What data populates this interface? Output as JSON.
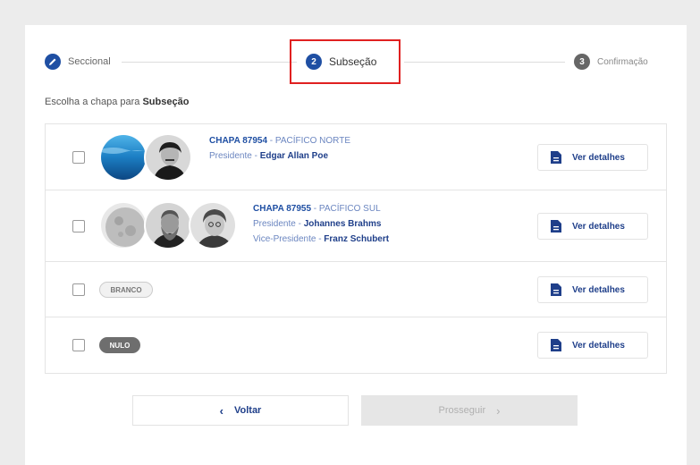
{
  "stepper": {
    "steps": [
      {
        "label": "Seccional",
        "state": "done"
      },
      {
        "label": "Subseção",
        "number": "2",
        "state": "active"
      },
      {
        "label": "Confirmação",
        "number": "3",
        "state": "pending"
      }
    ]
  },
  "prompt": {
    "text": "Escolha a chapa para ",
    "emphasis": "Subseção"
  },
  "options": [
    {
      "chapa": "CHAPA 87954",
      "region": " - PACÍFICO NORTE",
      "members": [
        {
          "role": "Presidente - ",
          "name": "Edgar Allan Poe"
        }
      ],
      "details_label": "Ver detalhes"
    },
    {
      "chapa": "CHAPA 87955",
      "region": " - PACÍFICO SUL",
      "members": [
        {
          "role": "Presidente - ",
          "name": "Johannes Brahms"
        },
        {
          "role": "Vice-Presidente - ",
          "name": "Franz Schubert"
        }
      ],
      "details_label": "Ver detalhes"
    },
    {
      "badge": "BRANCO",
      "details_label": "Ver detalhes"
    },
    {
      "badge": "NULO",
      "details_label": "Ver detalhes"
    }
  ],
  "footer": {
    "back_label": "Voltar",
    "next_label": "Prosseguir"
  },
  "colors": {
    "primary": "#1f4fa3",
    "highlight": "#e02020"
  }
}
